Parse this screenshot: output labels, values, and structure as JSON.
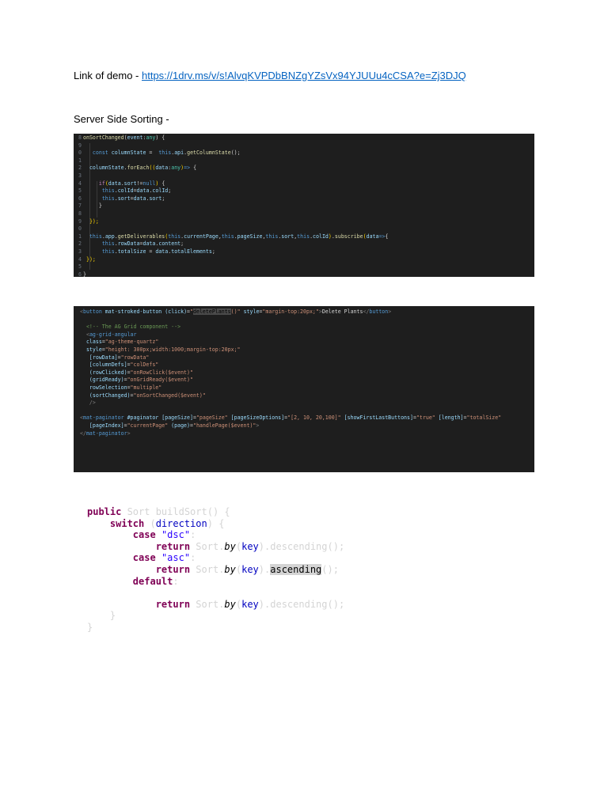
{
  "doc": {
    "demo_label": "Link of demo - ",
    "demo_url": "https://1drv.ms/v/s!AlvqKVPDbBNZgYZsVx94YJUUu4cCSA?e=Zj3DJQ",
    "section_heading": "Server Side Sorting -"
  },
  "snippet1": {
    "line_numbers": [
      "8",
      "9",
      "0",
      "1",
      "2",
      "3",
      "4",
      "5",
      "6",
      "7",
      "8",
      "9",
      "0",
      "1",
      "2",
      "3",
      "4",
      "5",
      "6"
    ],
    "lines": [
      [
        [
          "f",
          "onSortChanged"
        ],
        [
          "p",
          "("
        ],
        [
          "v",
          "event"
        ],
        [
          "p",
          ":"
        ],
        [
          "t",
          "any"
        ],
        [
          "p",
          ") {"
        ]
      ],
      [],
      [
        [
          "p",
          "   "
        ],
        [
          "k",
          "const"
        ],
        [
          "p",
          " "
        ],
        [
          "v",
          "columnState"
        ],
        [
          "p",
          " =  "
        ],
        [
          "k",
          "this"
        ],
        [
          "p",
          "."
        ],
        [
          "v",
          "api"
        ],
        [
          "p",
          "."
        ],
        [
          "f",
          "getColumnState"
        ],
        [
          "p",
          "();"
        ]
      ],
      [],
      [
        [
          "p",
          "  "
        ],
        [
          "v",
          "columnState"
        ],
        [
          "p",
          "."
        ],
        [
          "f",
          "forEach"
        ],
        [
          "y",
          "(("
        ],
        [
          "v",
          "data"
        ],
        [
          "p",
          ":"
        ],
        [
          "t",
          "any"
        ],
        [
          "y",
          ")"
        ],
        [
          "k",
          "=>"
        ],
        [
          "p",
          " {"
        ]
      ],
      [],
      [
        [
          "p",
          "     "
        ],
        [
          "m",
          "if"
        ],
        [
          "y",
          "("
        ],
        [
          "v",
          "data"
        ],
        [
          "p",
          "."
        ],
        [
          "v",
          "sort"
        ],
        [
          "p",
          "!="
        ],
        [
          "k",
          "null"
        ],
        [
          "y",
          ")"
        ],
        [
          "p",
          " {"
        ]
      ],
      [
        [
          "p",
          "      "
        ],
        [
          "k",
          "this"
        ],
        [
          "p",
          "."
        ],
        [
          "v",
          "colId"
        ],
        [
          "p",
          "="
        ],
        [
          "v",
          "data"
        ],
        [
          "p",
          "."
        ],
        [
          "v",
          "colId"
        ],
        [
          "p",
          ";"
        ]
      ],
      [
        [
          "p",
          "      "
        ],
        [
          "k",
          "this"
        ],
        [
          "p",
          "."
        ],
        [
          "v",
          "sort"
        ],
        [
          "p",
          "="
        ],
        [
          "v",
          "data"
        ],
        [
          "p",
          "."
        ],
        [
          "v",
          "sort"
        ],
        [
          "p",
          ";"
        ]
      ],
      [
        [
          "p",
          "     }"
        ]
      ],
      [],
      [
        [
          "p",
          "  "
        ],
        [
          "y",
          "});"
        ]
      ],
      [],
      [
        [
          "p",
          "  "
        ],
        [
          "k",
          "this"
        ],
        [
          "p",
          "."
        ],
        [
          "v",
          "app"
        ],
        [
          "p",
          "."
        ],
        [
          "f",
          "getDeliverables"
        ],
        [
          "y",
          "("
        ],
        [
          "k",
          "this"
        ],
        [
          "p",
          "."
        ],
        [
          "v",
          "currentPage"
        ],
        [
          "p",
          ","
        ],
        [
          "k",
          "this"
        ],
        [
          "p",
          "."
        ],
        [
          "v",
          "pageSize"
        ],
        [
          "p",
          ","
        ],
        [
          "k",
          "this"
        ],
        [
          "p",
          "."
        ],
        [
          "v",
          "sort"
        ],
        [
          "p",
          ","
        ],
        [
          "k",
          "this"
        ],
        [
          "p",
          "."
        ],
        [
          "v",
          "colId"
        ],
        [
          "y",
          ")"
        ],
        [
          "p",
          "."
        ],
        [
          "f",
          "subscribe"
        ],
        [
          "y",
          "("
        ],
        [
          "v",
          "data"
        ],
        [
          "k",
          "=>"
        ],
        [
          "p",
          "{"
        ]
      ],
      [
        [
          "p",
          "      "
        ],
        [
          "k",
          "this"
        ],
        [
          "p",
          "."
        ],
        [
          "v",
          "rowData"
        ],
        [
          "p",
          "="
        ],
        [
          "v",
          "data"
        ],
        [
          "p",
          "."
        ],
        [
          "v",
          "content"
        ],
        [
          "p",
          ";"
        ]
      ],
      [
        [
          "p",
          "      "
        ],
        [
          "k",
          "this"
        ],
        [
          "p",
          "."
        ],
        [
          "v",
          "totalSize"
        ],
        [
          "p",
          " = "
        ],
        [
          "v",
          "data"
        ],
        [
          "p",
          "."
        ],
        [
          "v",
          "totalElements"
        ],
        [
          "p",
          ";"
        ]
      ],
      [
        [
          "p",
          " "
        ],
        [
          "y",
          "});"
        ]
      ],
      [],
      [
        [
          "p",
          "}"
        ]
      ]
    ]
  },
  "snippet2": {
    "lines": [
      [
        [
          "tag",
          "<"
        ],
        [
          "tg",
          "button"
        ],
        [
          "p",
          " "
        ],
        [
          "at",
          "mat-stroked-button"
        ],
        [
          "p",
          " "
        ],
        [
          "at",
          "(click)"
        ],
        [
          "p",
          "="
        ],
        [
          "s",
          "\""
        ],
        [
          "hl",
          "deletePlants"
        ],
        [
          "s",
          "()\""
        ],
        [
          "p",
          " "
        ],
        [
          "at",
          "style"
        ],
        [
          "p",
          "="
        ],
        [
          "s",
          "\"margin-top:20px;\""
        ],
        [
          "tag",
          ">"
        ],
        [
          "p",
          "Delete Plants"
        ],
        [
          "tag",
          "</"
        ],
        [
          "tg",
          "button"
        ],
        [
          "tag",
          ">"
        ]
      ],
      [],
      [
        [
          "p",
          "  "
        ],
        [
          "c",
          "<!-- The AG Grid component -->"
        ]
      ],
      [
        [
          "p",
          "  "
        ],
        [
          "tag",
          "<"
        ],
        [
          "tg",
          "ag-grid-angular"
        ]
      ],
      [
        [
          "p",
          "  "
        ],
        [
          "at",
          "class"
        ],
        [
          "p",
          "="
        ],
        [
          "s",
          "\"ag-theme-quartz\""
        ]
      ],
      [
        [
          "p",
          "  "
        ],
        [
          "at",
          "style"
        ],
        [
          "p",
          "="
        ],
        [
          "s",
          "\"height: 300px;width:1000;margin-top:20px;\""
        ]
      ],
      [
        [
          "p",
          "   "
        ],
        [
          "at",
          "[rowData]"
        ],
        [
          "p",
          "="
        ],
        [
          "s",
          "\"rowData\""
        ]
      ],
      [
        [
          "p",
          "   "
        ],
        [
          "at",
          "[columnDefs]"
        ],
        [
          "p",
          "="
        ],
        [
          "s",
          "\"colDefs\""
        ]
      ],
      [
        [
          "p",
          "   "
        ],
        [
          "at",
          "(rowClicked)"
        ],
        [
          "p",
          "="
        ],
        [
          "s",
          "\"onRowClick($event)\""
        ]
      ],
      [
        [
          "p",
          "   "
        ],
        [
          "at",
          "(gridReady)"
        ],
        [
          "p",
          "="
        ],
        [
          "s",
          "\"onGridReady($event)\""
        ]
      ],
      [
        [
          "p",
          "   "
        ],
        [
          "at",
          "rowSelection"
        ],
        [
          "p",
          "="
        ],
        [
          "s",
          "\"multiple\""
        ]
      ],
      [
        [
          "p",
          "   "
        ],
        [
          "at",
          "(sortChanged)"
        ],
        [
          "p",
          "="
        ],
        [
          "s",
          "\"onSortChanged($event)\""
        ]
      ],
      [
        [
          "p",
          "   "
        ],
        [
          "tag",
          "/>"
        ]
      ],
      [],
      [
        [
          "tag",
          "<"
        ],
        [
          "tg",
          "mat-paginator"
        ],
        [
          "p",
          " "
        ],
        [
          "at",
          "#paginator"
        ],
        [
          "p",
          " "
        ],
        [
          "at",
          "[pageSize]"
        ],
        [
          "p",
          "="
        ],
        [
          "s",
          "\"pageSize\""
        ],
        [
          "p",
          " "
        ],
        [
          "at",
          "[pageSizeOptions]"
        ],
        [
          "p",
          "="
        ],
        [
          "s",
          "\"[2, 10, 20,100]\""
        ],
        [
          "p",
          " "
        ],
        [
          "at",
          "[showFirstLastButtons]"
        ],
        [
          "p",
          "="
        ],
        [
          "s",
          "\"true\""
        ],
        [
          "p",
          " "
        ],
        [
          "at",
          "[length]"
        ],
        [
          "p",
          "="
        ],
        [
          "s",
          "\"totalSize\""
        ]
      ],
      [
        [
          "p",
          "   "
        ],
        [
          "at",
          "[pageIndex]"
        ],
        [
          "p",
          "="
        ],
        [
          "s",
          "\"currentPage\""
        ],
        [
          "p",
          " "
        ],
        [
          "at",
          "(page)"
        ],
        [
          "p",
          "="
        ],
        [
          "s",
          "\"handlePage($event)\""
        ],
        [
          "tag",
          ">"
        ]
      ],
      [
        [
          "tag",
          "</"
        ],
        [
          "tg",
          "mat-paginator"
        ],
        [
          "tag",
          ">"
        ]
      ]
    ]
  },
  "snippet3": {
    "lines": [
      [
        [
          "jk",
          "public"
        ],
        [
          "p",
          " Sort buildSort() {"
        ]
      ],
      [
        [
          "p",
          "    "
        ],
        [
          "jk",
          "switch"
        ],
        [
          "p",
          " ("
        ],
        [
          "jv",
          "direction"
        ],
        [
          "p",
          ") {"
        ]
      ],
      [
        [
          "p",
          "        "
        ],
        [
          "jk",
          "case"
        ],
        [
          "p",
          " "
        ],
        [
          "js",
          "\"dsc\""
        ],
        [
          "p",
          ":"
        ]
      ],
      [
        [
          "p",
          "            "
        ],
        [
          "jk",
          "return"
        ],
        [
          "p",
          " Sort."
        ],
        [
          "ji",
          "by"
        ],
        [
          "p",
          "("
        ],
        [
          "jv",
          "key"
        ],
        [
          "p",
          ").descending();"
        ]
      ],
      [
        [
          "p",
          "        "
        ],
        [
          "jk",
          "case"
        ],
        [
          "p",
          " "
        ],
        [
          "js",
          "\"asc\""
        ],
        [
          "p",
          ":"
        ]
      ],
      [
        [
          "p",
          "            "
        ],
        [
          "jk",
          "return"
        ],
        [
          "p",
          " Sort."
        ],
        [
          "ji",
          "by"
        ],
        [
          "p",
          "("
        ],
        [
          "jv",
          "key"
        ],
        [
          "p",
          ")."
        ],
        [
          "jhl",
          "ascending"
        ],
        [
          "p",
          "();"
        ]
      ],
      [
        [
          "p",
          "        "
        ],
        [
          "jk",
          "default"
        ],
        [
          "p",
          ":"
        ]
      ],
      [],
      [
        [
          "p",
          "            "
        ],
        [
          "jk",
          "return"
        ],
        [
          "p",
          " Sort."
        ],
        [
          "ji",
          "by"
        ],
        [
          "p",
          "("
        ],
        [
          "jv",
          "key"
        ],
        [
          "p",
          ").descending();"
        ]
      ],
      [
        [
          "p",
          "    }"
        ]
      ],
      [
        [
          "p",
          "}"
        ]
      ]
    ]
  }
}
